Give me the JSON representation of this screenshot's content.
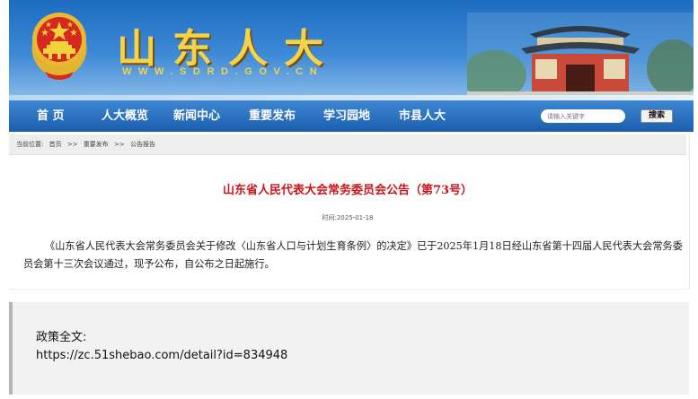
{
  "header": {
    "site_title": "山东人大",
    "site_url": "WWW.SDRD.GOV.CN"
  },
  "nav": {
    "items": [
      "首 页",
      "人大概览",
      "新闻中心",
      "重要发布",
      "学习园地",
      "市县人大"
    ],
    "search_placeholder": "请输入关键字",
    "search_button": "搜索"
  },
  "breadcrumb": {
    "prefix": "当前位置:",
    "path": [
      "首页",
      "重要发布",
      "公告报告"
    ],
    "separator": ">>"
  },
  "article": {
    "title": "山东省人民代表大会常务委员会公告（第73号）",
    "time": "时间:2025-01-18",
    "body": "《山东省人民代表大会常务委员会关于修改〈山东省人口与计划生育条例〉的决定》已于2025年1月18日经山东省第十四届人民代表大会常务委员会第十三次会议通过，现予公布，自公布之日起施行。"
  },
  "policy": {
    "label": "政策全文:",
    "link": "https://zc.51shebao.com/detail?id=834948"
  },
  "colors": {
    "banner_blue": "#1c6cc0",
    "nav_blue": "#1b5fae",
    "title_gold": "#f4d24a",
    "article_title_red": "#c8161d"
  },
  "icons": {
    "emblem": "national-emblem-icon",
    "gate": "ancient-gate-image"
  }
}
